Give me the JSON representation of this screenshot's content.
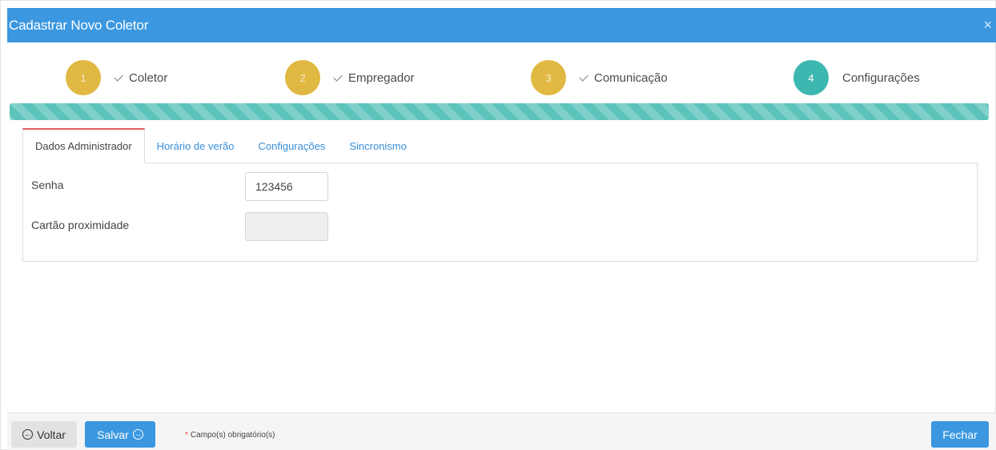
{
  "header": {
    "title": "Cadastrar Novo Coletor",
    "close_glyph": "×"
  },
  "steps": [
    {
      "number": "1",
      "label": "Coletor",
      "state": "done"
    },
    {
      "number": "2",
      "label": "Empregador",
      "state": "done"
    },
    {
      "number": "3",
      "label": "Comunicação",
      "state": "done"
    },
    {
      "number": "4",
      "label": "Configurações",
      "state": "active"
    }
  ],
  "progress": {
    "percent": 100,
    "color": "#5cc3bb"
  },
  "tabs": [
    {
      "label": "Dados Administrador",
      "active": true
    },
    {
      "label": "Horário de verão",
      "active": false
    },
    {
      "label": "Configurações",
      "active": false
    },
    {
      "label": "Sincronismo",
      "active": false
    }
  ],
  "form": {
    "senha": {
      "label": "Senha",
      "value": "123456"
    },
    "cartao": {
      "label": "Cartão proximidade",
      "value": "",
      "disabled": true
    }
  },
  "footer": {
    "back_label": "Voltar",
    "save_label": "Salvar",
    "required_asterisk": "*",
    "required_note": "Campo(s) obrigatório(s)",
    "close_label": "Fechar"
  },
  "colors": {
    "primary": "#3a97e0",
    "step_done": "#e0b842",
    "step_active": "#3db8b0",
    "tab_active_border": "#e25d5d",
    "required": "#e53935"
  }
}
